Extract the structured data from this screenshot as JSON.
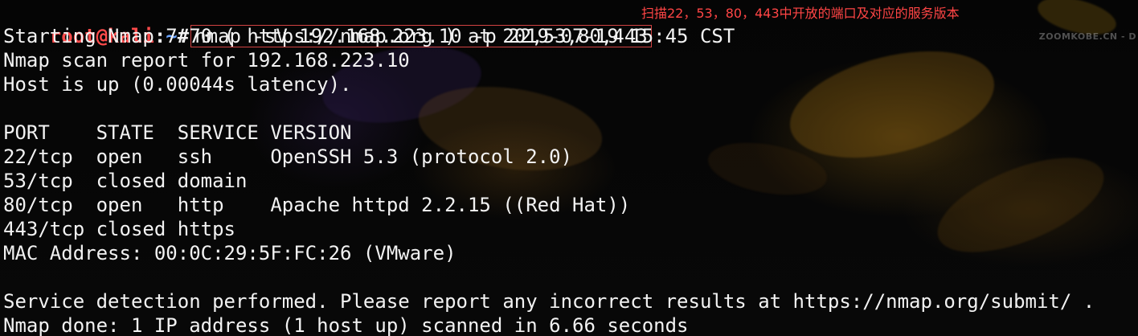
{
  "window": {
    "title": "Terminal"
  },
  "prompt": {
    "user_host": "root@kali",
    "separator": ":",
    "path": "~",
    "symbol": "#"
  },
  "command": "nmap -sV 192.168.223.10 -p 22,53,80,443",
  "annotation": "扫描22，53，80，443中开放的端口及对应的服务版本",
  "brand": "ZOOMKOBE.CN - D",
  "output_lines": [
    "Starting Nmap 7.70 ( https://nmap.org ) at 2019-07-19 15:45 CST",
    "Nmap scan report for 192.168.223.10",
    "Host is up (0.00044s latency).",
    "",
    "PORT    STATE  SERVICE VERSION",
    "22/tcp  open   ssh     OpenSSH 5.3 (protocol 2.0)",
    "53/tcp  closed domain",
    "80/tcp  open   http    Apache httpd 2.2.15 ((Red Hat))",
    "443/tcp closed https",
    "MAC Address: 00:0C:29:5F:FC:26 (VMware)",
    "",
    "Service detection performed. Please report any incorrect results at https://nmap.org/submit/ .",
    "Nmap done: 1 IP address (1 host up) scanned in 6.66 seconds"
  ],
  "colors": {
    "prompt_user": "#ff4b4b",
    "prompt_path": "#6aa4ff",
    "text": "#f2f2f2",
    "highlight_box": "#d24242",
    "annotation": "#ff4545"
  }
}
